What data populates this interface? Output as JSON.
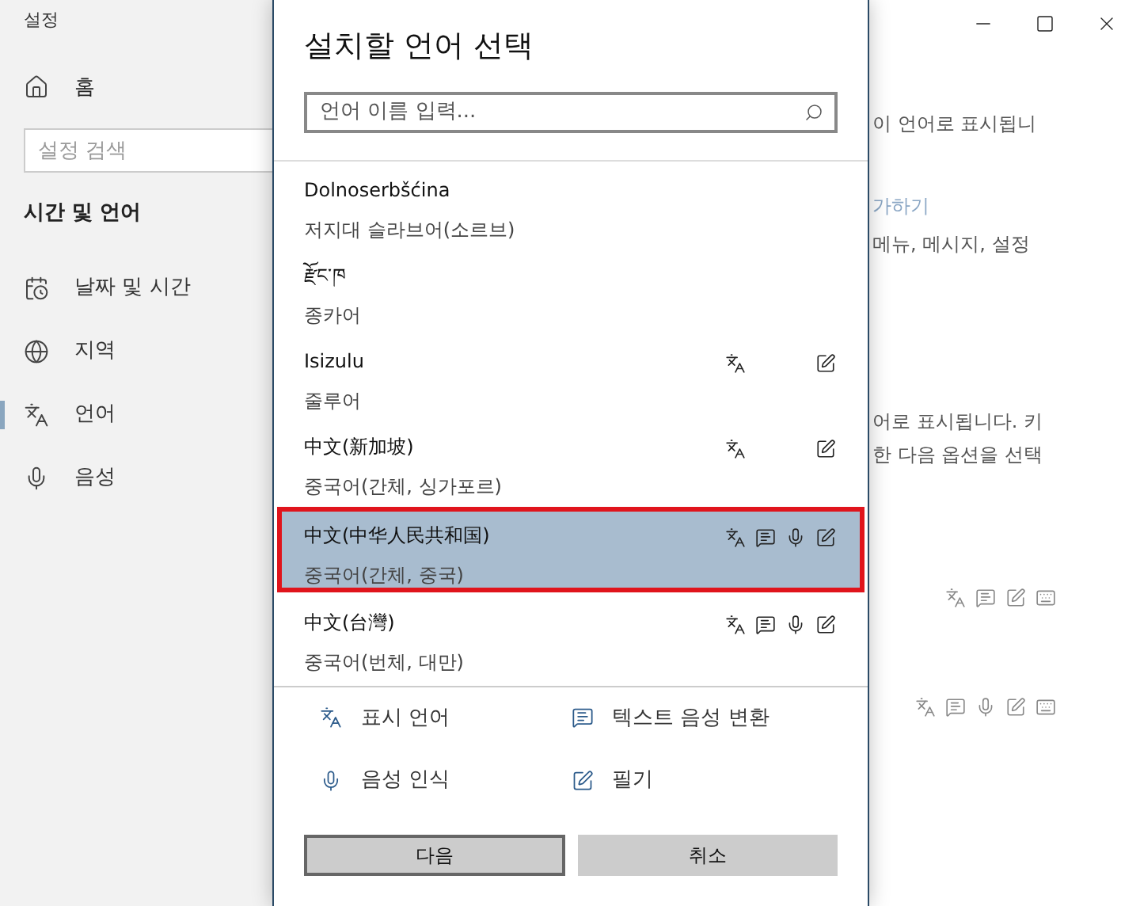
{
  "settings_window": {
    "title": "설정",
    "home": "홈",
    "search": {
      "placeholder": "설정 검색"
    },
    "section": "시간 및 언어",
    "nav": [
      {
        "kind": "date",
        "label": "날짜 및 시간",
        "selected": false
      },
      {
        "kind": "region",
        "label": "지역",
        "selected": false
      },
      {
        "kind": "language",
        "label": "언어",
        "selected": true
      },
      {
        "kind": "speech",
        "label": "음성",
        "selected": false
      }
    ],
    "content_fragments": [
      {
        "kind": "text",
        "text": "이 언어로 표시됩니"
      },
      {
        "kind": "link",
        "text": "가하기"
      },
      {
        "kind": "text",
        "text": "메뉴, 메시지, 설정"
      },
      {
        "kind": "text",
        "text": "어로 표시됩니다. 키"
      },
      {
        "kind": "text",
        "text": "한 다음 옵션을 선택"
      }
    ],
    "content_features": [
      {
        "display": true,
        "tts": true,
        "speech": false,
        "handwriting": true,
        "keyboard": true
      },
      {
        "display": true,
        "tts": true,
        "speech": true,
        "handwriting": true,
        "keyboard": true
      }
    ]
  },
  "dialog": {
    "title": "설치할 언어 선택",
    "search": {
      "placeholder": "언어 이름 입력..."
    },
    "languages": [
      {
        "name": "Dolnoserbšćina",
        "korean": "저지대 슬라브어(소르브)",
        "selected": false,
        "display": false,
        "tts": false,
        "speech": false,
        "handwriting": false
      },
      {
        "name": "རྫོང་ཁ",
        "korean": "종카어",
        "selected": false,
        "display": false,
        "tts": false,
        "speech": false,
        "handwriting": false
      },
      {
        "name": "Isizulu",
        "korean": "줄루어",
        "selected": false,
        "display": true,
        "tts": false,
        "speech": false,
        "handwriting": true
      },
      {
        "name": "中文(新加坡)",
        "korean": "중국어(간체, 싱가포르)",
        "selected": false,
        "display": true,
        "tts": false,
        "speech": false,
        "handwriting": true
      },
      {
        "name": "中文(中华人民共和国)",
        "korean": "중국어(간체, 중국)",
        "selected": true,
        "display": true,
        "tts": true,
        "speech": true,
        "handwriting": true
      },
      {
        "name": "中文(台灣)",
        "korean": "중국어(번체, 대만)",
        "selected": false,
        "display": true,
        "tts": true,
        "speech": true,
        "handwriting": true
      }
    ],
    "legend": [
      {
        "kind": "display",
        "label": "표시 언어"
      },
      {
        "kind": "tts",
        "label": "텍스트 음성 변환"
      },
      {
        "kind": "speech",
        "label": "음성 인식"
      },
      {
        "kind": "handwriting",
        "label": "필기"
      }
    ],
    "buttons": [
      {
        "kind": "primary",
        "label": "다음"
      },
      {
        "kind": "secondary",
        "label": "취소"
      }
    ]
  }
}
